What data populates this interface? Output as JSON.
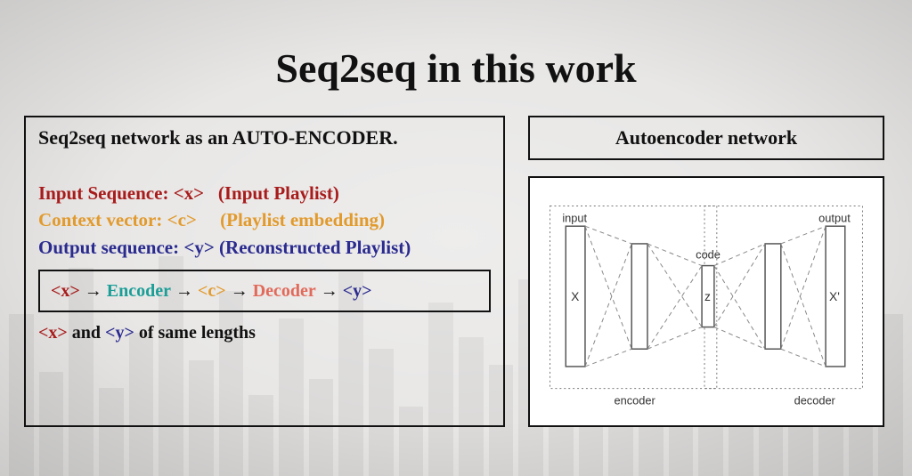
{
  "title": "Seq2seq in this work",
  "left": {
    "heading": "Seq2seq network as an AUTO-ENCODER.",
    "input_label": "Input Sequence: ",
    "input_tag": "<x>",
    "input_desc": "   (Input Playlist)",
    "context_label": "Context vector: ",
    "context_tag": "<c>",
    "context_desc": "     (Playlist embedding)",
    "output_label": "Output sequence: ",
    "output_tag": "<y>",
    "output_desc": " (Reconstructed Playlist)",
    "flow": {
      "x": "<x>",
      "arrow": " → ",
      "encoder": "Encoder",
      "c": "<c>",
      "decoder": "Decoder",
      "y": "<y>"
    },
    "same_lengths_x": "<x>",
    "same_lengths_and": " and ",
    "same_lengths_y": "<y>",
    "same_lengths_tail": " of same lengths"
  },
  "right": {
    "title": "Autoencoder network",
    "diagram": {
      "input_label": "input",
      "output_label": "output",
      "code_label": "code",
      "X": "X",
      "z": "z",
      "Xp": "X'",
      "encoder_label": "encoder",
      "decoder_label": "decoder"
    }
  }
}
